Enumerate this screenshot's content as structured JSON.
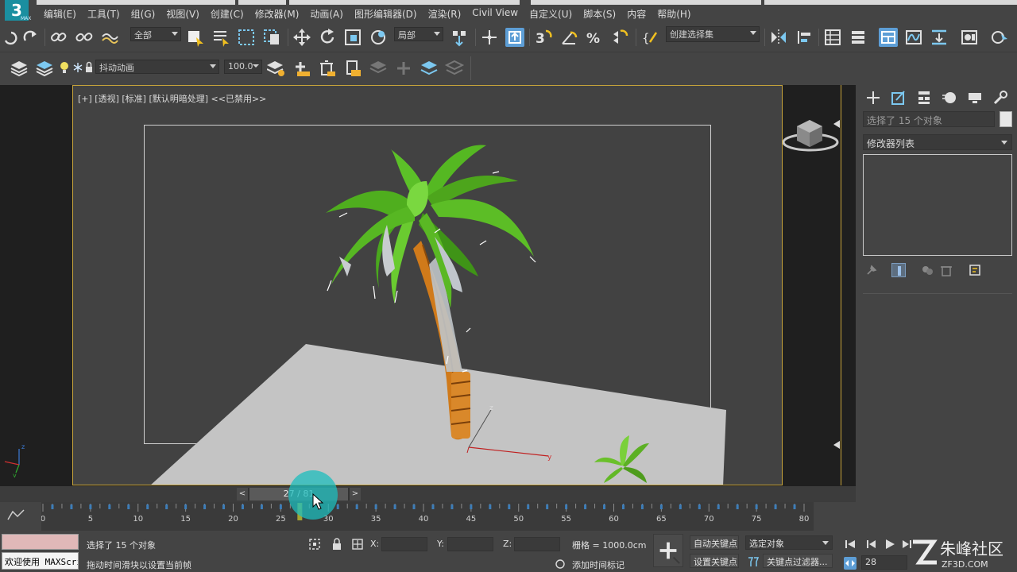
{
  "app": {
    "logo_text": "3",
    "logo_sub": "MAX"
  },
  "menu": [
    "编辑(E)",
    "工具(T)",
    "组(G)",
    "视图(V)",
    "创建(C)",
    "修改器(M)",
    "动画(A)",
    "图形编辑器(D)",
    "渲染(R)",
    "Civil View",
    "自定义(U)",
    "脚本(S)",
    "内容",
    "帮助(H)"
  ],
  "toolbar1": {
    "selection_filter": "全部",
    "ref_coord": "局部",
    "named_selection": "创建选择集"
  },
  "toolbar2": {
    "layer_name": "抖动动画",
    "percent": "100.0"
  },
  "viewport": {
    "label": "[+] [透视] [标准] [默认明暗处理] <<已禁用>>",
    "axis_y": "y",
    "axis_z": "z",
    "gizmo_z": "z",
    "gizmo_x": "x",
    "gizmo_y": "y"
  },
  "command_panel": {
    "selection_info": "选择了 15 个对象",
    "modifier_list": "修改器列表"
  },
  "time_slider": {
    "prev": "<",
    "next": ">",
    "label": "27 / 81",
    "current_frame": 27,
    "total_frames": 81
  },
  "trackbar": {
    "ticks": [
      "0",
      "5",
      "10",
      "15",
      "20",
      "25",
      "30",
      "35",
      "40",
      "45",
      "50",
      "55",
      "60",
      "65",
      "70",
      "75",
      "80"
    ]
  },
  "status": {
    "listener_text": "欢迎使用 MAXScript",
    "line1": "选择了 15 个对象",
    "line2": "拖动时间滑块以设置当前帧",
    "x_label": "X:",
    "y_label": "Y:",
    "z_label": "Z:",
    "grid": "栅格 = 1000.0cm",
    "add_time_tag": "添加时间标记",
    "auto_key": "自动关键点",
    "set_key": "设置关键点",
    "key_mode": "选定对象",
    "key_filters": "关键点过滤器...",
    "frame_value": "28"
  },
  "watermark": {
    "brand": "朱峰社区",
    "url": "ZF3D.COM"
  },
  "colors": {
    "accent_yellow": "#c8a43a",
    "halo": "#1ebebe",
    "active_blue": "#5d9ed6"
  }
}
